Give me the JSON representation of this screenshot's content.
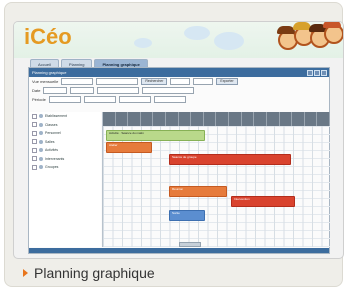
{
  "logo": "iCéo",
  "tabs": [
    "Accueil",
    "Planning",
    "Planning graphique"
  ],
  "window_title": "Planning graphique",
  "filters": {
    "row1_label": "Vue mensuelle",
    "row2_label": "Date",
    "row3_label": "Période",
    "buttons": [
      "Rechercher",
      "Exporter"
    ]
  },
  "tree_items": [
    "Etablissement",
    "Classes",
    "Personnel",
    "Salles",
    "Activités",
    "Intervenants",
    "Groupes"
  ],
  "bars": [
    {
      "color": "green",
      "label": "Activité · Séance du matin"
    },
    {
      "color": "orange",
      "label": "Atelier"
    },
    {
      "color": "red",
      "label": "Séance de groupe"
    },
    {
      "color": "orange",
      "label": "Réunion"
    },
    {
      "color": "red",
      "label": "Intervention"
    },
    {
      "color": "blue",
      "label": "Sortie"
    }
  ],
  "caption": "Planning graphique"
}
